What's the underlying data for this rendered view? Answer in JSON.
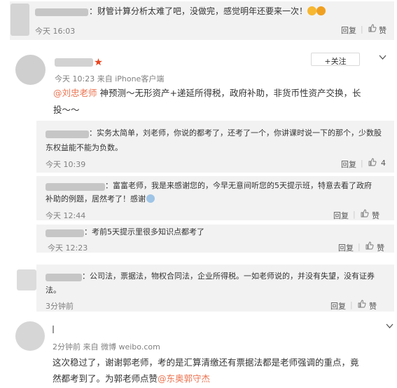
{
  "top_comment": {
    "text": "：财管计算分析太难了吧，没做完，感觉明年还要来一次！",
    "time": "今天 16:03",
    "reply_label": "回复",
    "like_label": "赞"
  },
  "post": {
    "meta": "今天 10:23 来自 iPhone客户端",
    "follow_label": "+关注",
    "mention": "@刘忠老师",
    "line1": " 神预测～无形资产+递延所得税，政府补助，非货币性资产交换，长",
    "line2": "投～～"
  },
  "replies": [
    {
      "line1": "：实务太简单，刘老师，你说的都考了，还考了一个，你讲课时说一下的那个，少数股",
      "line2": "东权益能不能为负数。",
      "time": "今天 10:39",
      "reply_label": "回复",
      "like_count": "4"
    },
    {
      "line1": "：富富老师，我是来感谢您的，今早无意间听您的5天提示班，特意去看了政府",
      "line2": "补助的例题，居然考了！感谢",
      "time": "今天 12:44",
      "reply_label": "回复",
      "like_label": "赞"
    },
    {
      "line1": "：考前5天提示里很多知识点都考了",
      "time": "今天 12:23",
      "reply_label": "回复",
      "like_label": "赞"
    },
    {
      "line1": "：公司法，票据法，物权合同法，企业所得税。一如老师说的，并没有失望，没有证券",
      "line2": "法。",
      "time": "3分钟前",
      "reply_label": "回复",
      "like_label": "赞"
    }
  ],
  "bottom_post": {
    "meta": "2分钟前 来自 微博 weibo.com",
    "line1": "这次稳过了，谢谢郭老师，考的是汇算清缴还有票据法都是老师强调的重点，竟",
    "line2_text": "然都考到了。为郭老师点赞",
    "line2_mention": "@东奥郭守杰"
  },
  "colors": {
    "accent": "#eb7350",
    "time_gray": "#808080",
    "block_bg": "#f2f2f2",
    "star_red": "#e8441f"
  }
}
